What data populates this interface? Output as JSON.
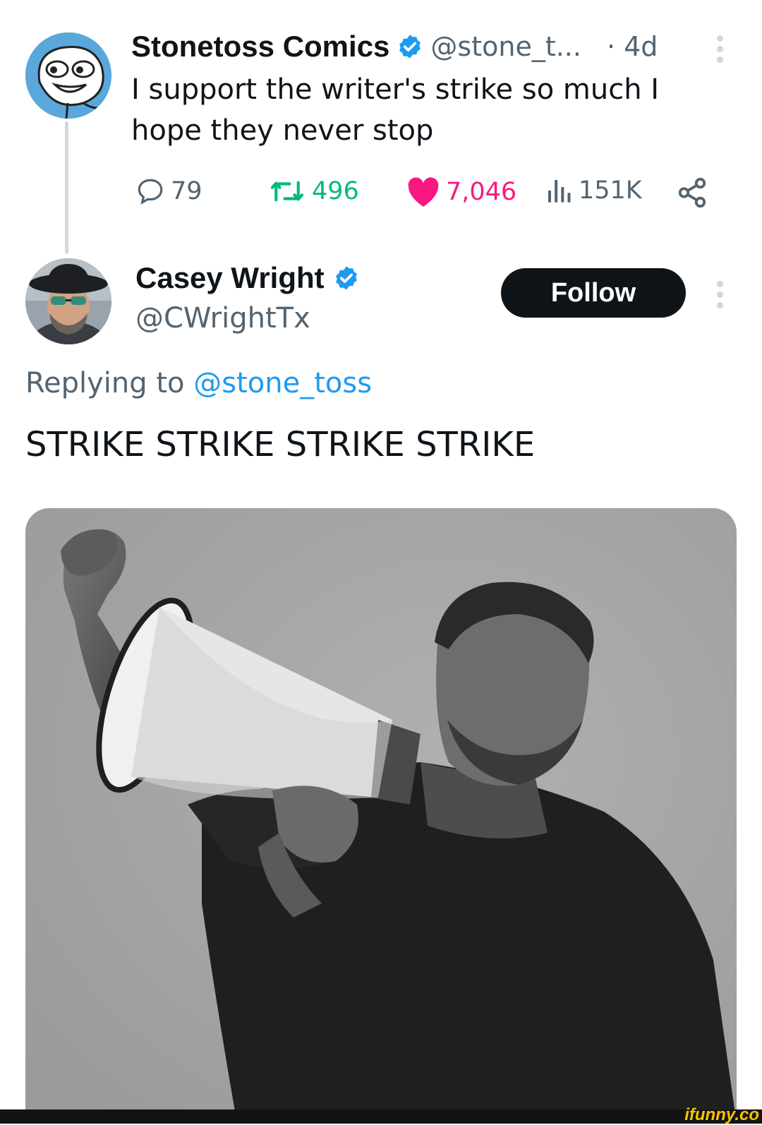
{
  "original_tweet": {
    "display_name": "Stonetoss Comics",
    "handle": "@stone_t...",
    "time": "· 4d",
    "text_line1": "I support the writer's strike so much I",
    "text_line2": "hope they never stop",
    "metrics": {
      "replies": "79",
      "retweets": "496",
      "likes": "7,046",
      "views": "151K"
    }
  },
  "reply_tweet": {
    "display_name": "Casey Wright",
    "handle": "@CWrightTx",
    "follow_label": "Follow",
    "replying_prefix": "Replying to ",
    "replying_mention": "@stone_toss",
    "text": "STRIKE STRIKE STRIKE STRIKE"
  },
  "watermark": "ifunny.co",
  "colors": {
    "verified": "#1d9bf0",
    "retweet": "#00ba7c",
    "like": "#f91880",
    "text_secondary": "#536471"
  }
}
